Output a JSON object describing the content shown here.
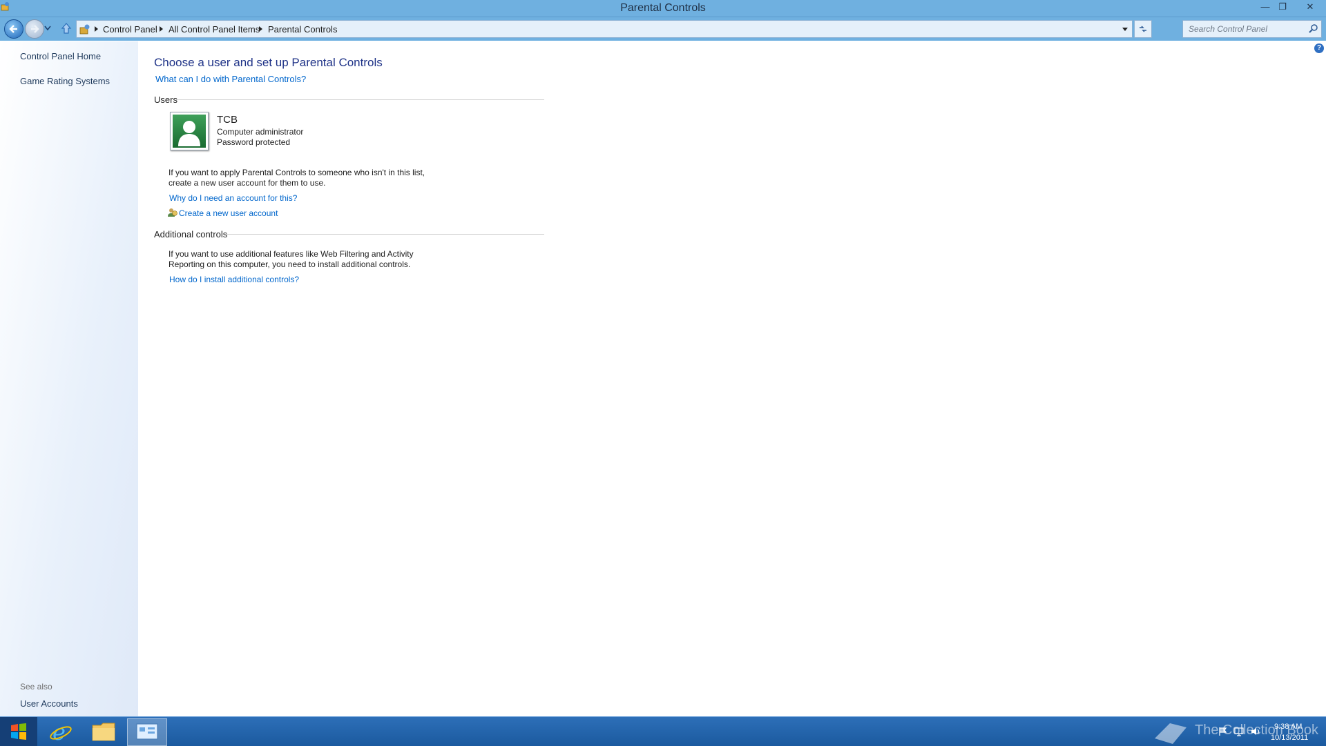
{
  "window": {
    "title": "Parental Controls"
  },
  "address": {
    "crumbs": [
      "Control Panel",
      "All Control Panel Items",
      "Parental Controls"
    ],
    "search_placeholder": "Search Control Panel"
  },
  "sidebar": {
    "items": [
      {
        "label": "Control Panel Home"
      },
      {
        "label": "Game Rating Systems"
      }
    ],
    "see_also_label": "See also",
    "see_also_items": [
      {
        "label": "User Accounts"
      }
    ]
  },
  "main": {
    "heading": "Choose a user and set up Parental Controls",
    "help_link": "What can I do with Parental Controls?",
    "users_group": "Users",
    "user": {
      "name": "TCB",
      "role": "Computer administrator",
      "status": "Password protected"
    },
    "apply_text_1": "If you want to apply Parental Controls to someone who isn't in this list,",
    "apply_text_2": "create a new user account for them to use.",
    "why_link": "Why do I need an account for this?",
    "create_link": "Create a new user account",
    "additional_group": "Additional controls",
    "additional_text_1": "If you want to use additional features like Web Filtering and Activity",
    "additional_text_2": "Reporting on this computer, you need to install additional controls.",
    "install_link": "How do I install additional controls?"
  },
  "taskbar": {
    "time": "9:38 AM",
    "date": "10/13/2011",
    "watermark": "The Collection Book"
  },
  "colors": {
    "accent": "#6fb0e0",
    "link": "#0066cc",
    "heading": "#1e3287",
    "taskbar": "#1b5a9f"
  }
}
